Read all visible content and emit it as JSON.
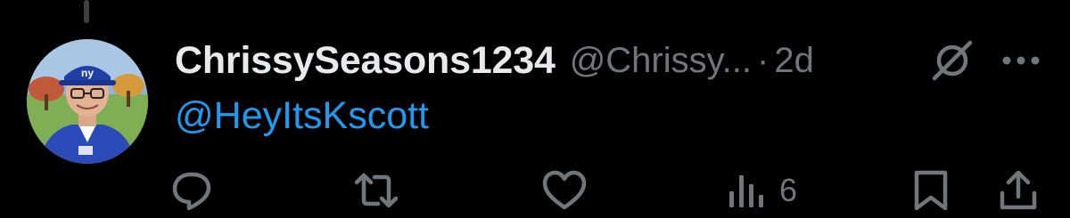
{
  "tweet": {
    "display_name": "ChrissySeasons1234",
    "handle": "@Chrissy...",
    "separator": "·",
    "time": "2d",
    "mention": "@HeyItsKscott",
    "avatar_icon": "user-avatar-photo",
    "header_icons": [
      "grok-icon",
      "more-icon"
    ]
  },
  "actions": {
    "reply_icon": "reply-icon",
    "repost_icon": "repost-icon",
    "like_icon": "like-icon",
    "views_icon": "views-icon",
    "views_count": "6",
    "bookmark_icon": "bookmark-icon",
    "share_icon": "share-icon"
  },
  "colors": {
    "background": "#000000",
    "text_primary": "#e7e9ea",
    "text_secondary": "#71767b",
    "accent": "#1d9bf0"
  }
}
